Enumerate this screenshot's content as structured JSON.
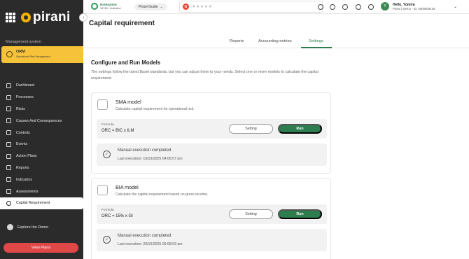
{
  "brand": {
    "logo_text": "pirani"
  },
  "sidebar": {
    "section_label": "Management system",
    "module": {
      "title": "ORM",
      "subtitle": "Operational Risk Management"
    },
    "items": [
      {
        "label": "Dashboard",
        "icon": "dashboard-icon"
      },
      {
        "label": "Processes",
        "icon": "processes-icon"
      },
      {
        "label": "Risks",
        "icon": "risks-icon"
      },
      {
        "label": "Causes And Consequences",
        "icon": "causes-icon"
      },
      {
        "label": "Controls",
        "icon": "controls-icon"
      },
      {
        "label": "Events",
        "icon": "events-icon"
      },
      {
        "label": "Action Plans",
        "icon": "action-plans-icon"
      },
      {
        "label": "Reports",
        "icon": "reports-icon"
      },
      {
        "label": "Indicators",
        "icon": "indicators-icon"
      },
      {
        "label": "Assessments",
        "icon": "assessments-icon"
      },
      {
        "label": "Capital Requirement",
        "icon": "capital-icon",
        "active": true
      }
    ],
    "explore_label": "Explore the Demo",
    "view_plans_label": "View Plans"
  },
  "topbar": {
    "plan_title": "Enterprise",
    "plan_sub": "15746 / Unlimited",
    "guide_label": "Pirani Guide",
    "rating_stars": "★★★★★",
    "user_greeting": "Hello, Yomira",
    "user_sub": "Pirani | Demo - ID: 0000000419",
    "avatar_letter": "Y"
  },
  "main": {
    "page_title": "Capital requirement",
    "tabs": [
      "Reports",
      "Accounting entries",
      "Settings"
    ],
    "active_tab": "Settings",
    "section_title": "Configure and Run Models",
    "section_desc": "The settings follow the latest Basel standards, but you can adjust them to your needs. Select one or more models to calculate the capital requirement.",
    "models": [
      {
        "title": "SMA model",
        "desc": "Calculate capital requirement for operational risk.",
        "formula_label": "Formula",
        "formula": "ORC = BIC x ILM",
        "setting_label": "Setting",
        "run_label": "Run",
        "exec_title": "Manual execution completed",
        "exec_last": "Last execution: 16/10/2025 04:06:57 pm"
      },
      {
        "title": "BIA model",
        "desc": "Calculate the capital requirement based on gross income.",
        "formula_label": "Formula",
        "formula": "ORC = 15% x GI",
        "setting_label": "Setting",
        "run_label": "Run",
        "exec_title": "Manual execution completed",
        "exec_last": "Last execution: 20/10/2025 09:08:03 am"
      }
    ]
  },
  "colors": {
    "accent": "#2e7d4f",
    "brand_yellow": "#f5b300",
    "danger": "#e04848",
    "sidebar_bg": "#2b2b2b"
  }
}
